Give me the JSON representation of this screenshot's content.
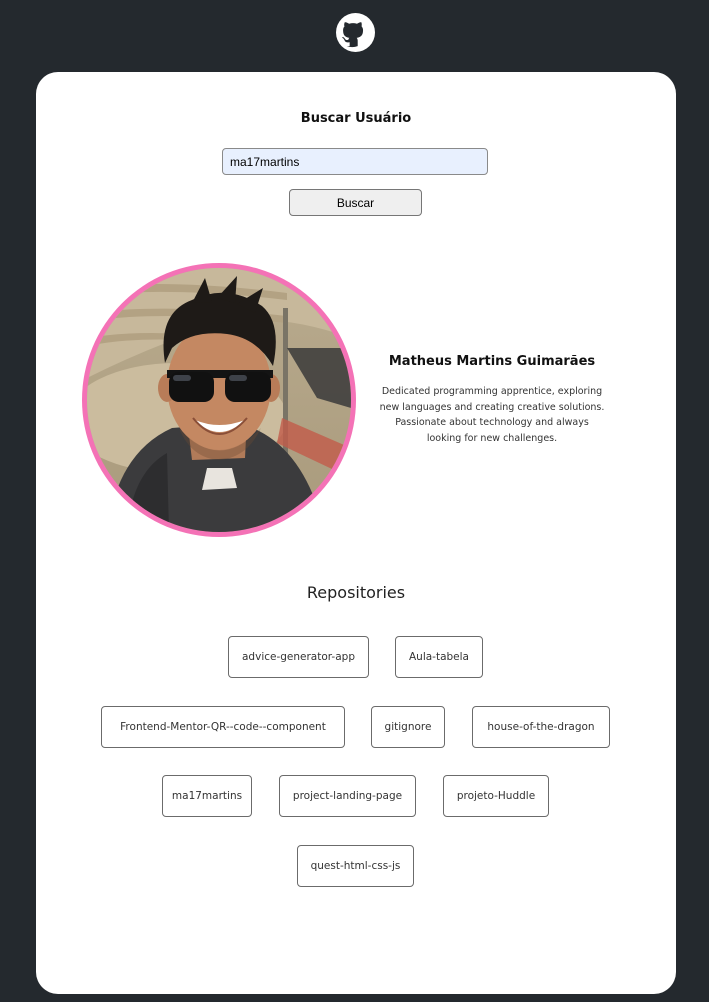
{
  "header": {
    "logo_icon": "github-octocat-icon"
  },
  "search": {
    "title": "Buscar Usuário",
    "input_value": "ma17martins",
    "button_label": "Buscar"
  },
  "profile": {
    "name": "Matheus Martins Guimarães",
    "bio": "Dedicated programming apprentice, exploring new languages and creating creative solutions. Passionate about technology and always looking for new challenges.",
    "avatar_ring_color": "#f472b6"
  },
  "repositories": {
    "title": "Repositories",
    "items": [
      "advice-generator-app",
      "Aula-tabela",
      "Frontend-Mentor-QR--code--component",
      "gitignore",
      "house-of-the-dragon",
      "ma17martins",
      "project-landing-page",
      "projeto-Huddle",
      "quest-html-css-js"
    ]
  },
  "colors": {
    "background": "#24292e",
    "card": "#ffffff",
    "input_bg": "#e8f0fe"
  }
}
